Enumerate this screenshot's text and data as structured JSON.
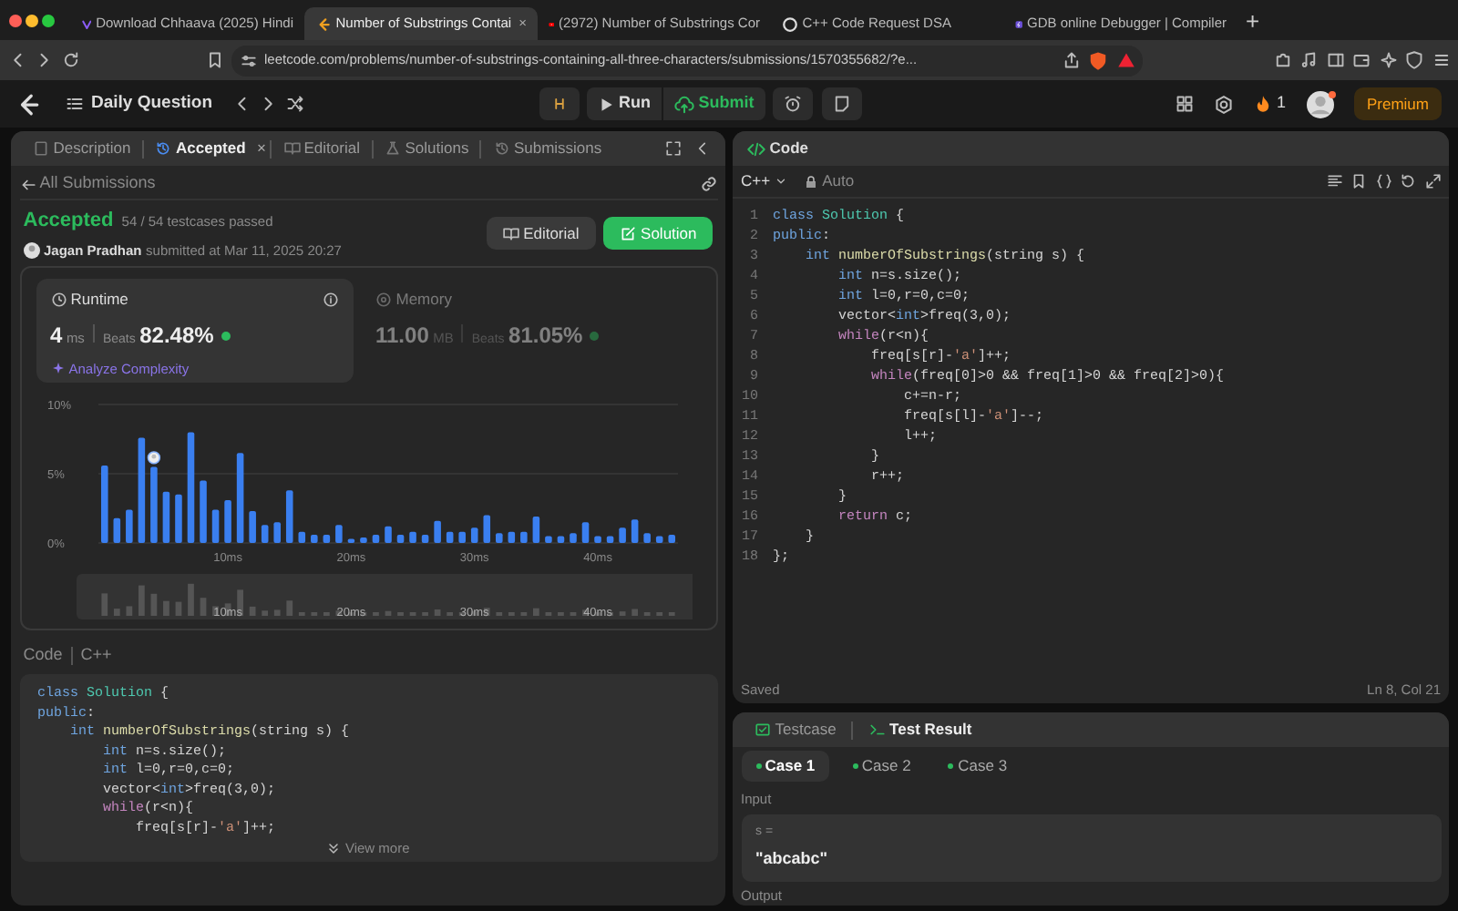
{
  "browser_tabs": [
    {
      "title": "Download Chhaava (2025) Hindi",
      "kind": "vmovie",
      "selected": false
    },
    {
      "title": "Number of Substrings Contai",
      "kind": "leetcode",
      "selected": true,
      "close": "×"
    },
    {
      "title": "(2972) Number of Substrings Cor",
      "kind": "youtube",
      "selected": false
    },
    {
      "title": "C++ Code Request DSA",
      "kind": "chat",
      "selected": false
    },
    {
      "title": "GDB online Debugger | Compiler",
      "kind": "gdb",
      "selected": false
    }
  ],
  "new_tab": "+",
  "address": "leetcode.com/problems/number-of-substrings-containing-all-three-characters/submissions/1570355682/?e...",
  "topbar": {
    "title": "Daily Question",
    "run": "Run",
    "submit": "Submit",
    "streak": "1",
    "premium": "Premium"
  },
  "left_tabs": [
    {
      "label": "Description",
      "kind": "doc",
      "selected": false
    },
    {
      "label": "Accepted",
      "kind": "history",
      "selected": true,
      "close": "×"
    },
    {
      "label": "Editorial",
      "kind": "book",
      "selected": false
    },
    {
      "label": "Solutions",
      "kind": "flask",
      "selected": false
    },
    {
      "label": "Submissions",
      "kind": "history",
      "selected": false
    }
  ],
  "back_link": "All Submissions",
  "submission": {
    "status": "Accepted",
    "testcases": "54 / 54 testcases passed",
    "user": "Jagan Pradhan",
    "submitted": "submitted at Mar 11, 2025 20:27",
    "editorial_button": "Editorial",
    "solution_button": "Solution"
  },
  "stats": [
    {
      "title": "Runtime",
      "value": "4",
      "unit": "ms",
      "beats_label": "Beats",
      "beats": "82.48%",
      "selected": true,
      "analyze": "Analyze Complexity"
    },
    {
      "title": "Memory",
      "value": "11.00",
      "unit": "MB",
      "beats_label": "Beats",
      "beats": "81.05%",
      "selected": false
    }
  ],
  "chart_data": {
    "type": "bar",
    "x": [
      0,
      1,
      2,
      3,
      4,
      5,
      6,
      7,
      8,
      9,
      10,
      11,
      12,
      13,
      14,
      15,
      16,
      17,
      18,
      19,
      20,
      21,
      22,
      23,
      24,
      25,
      26,
      27,
      28,
      29,
      30,
      31,
      32,
      33,
      34,
      35,
      36,
      37,
      38,
      39,
      40,
      41,
      42,
      43,
      44,
      45,
      46
    ],
    "values": [
      5.6,
      1.8,
      2.4,
      7.6,
      5.5,
      3.7,
      3.5,
      8.0,
      4.5,
      2.4,
      3.1,
      6.5,
      2.3,
      1.3,
      1.5,
      3.8,
      0.8,
      0.6,
      0.6,
      1.3,
      0.3,
      0.4,
      0.6,
      1.2,
      0.6,
      0.8,
      0.6,
      1.6,
      0.8,
      0.8,
      1.1,
      2.0,
      0.7,
      0.8,
      0.8,
      1.9,
      0.5,
      0.5,
      0.7,
      1.5,
      0.5,
      0.5,
      1.1,
      1.7,
      0.7,
      0.5,
      0.6
    ],
    "xlim": [
      -0.5,
      46.5
    ],
    "xticks": [
      {
        "value": 10,
        "label": "10ms"
      },
      {
        "value": 20,
        "label": "20ms"
      },
      {
        "value": 30,
        "label": "30ms"
      },
      {
        "value": 40,
        "label": "40ms"
      }
    ],
    "yticks": [
      {
        "value": 0,
        "label": "0%"
      },
      {
        "value": 5,
        "label": "5%"
      },
      {
        "value": 10,
        "label": "10%"
      }
    ],
    "ylim": [
      0,
      10
    ]
  },
  "overview_labels": [
    "10ms",
    "20ms",
    "30ms",
    "40ms"
  ],
  "code_preview": {
    "label": "Code",
    "language": "C++",
    "view_more": "View more",
    "lines": [
      [
        {
          "text": "class ",
          "kind": "keyword"
        },
        {
          "text": "Solution",
          "kind": "type"
        },
        {
          "text": " {"
        }
      ],
      [
        {
          "text": "public",
          "kind": "keyword"
        },
        {
          "text": ":"
        }
      ],
      [
        {
          "text": "    int ",
          "kind": "keyword"
        },
        {
          "text": "numberOfSubstrings",
          "kind": "function"
        },
        {
          "text": "(string s) {"
        }
      ],
      [
        {
          "text": "        int ",
          "kind": "keyword"
        },
        {
          "text": "n=s.size();"
        }
      ],
      [
        {
          "text": "        int ",
          "kind": "keyword"
        },
        {
          "text": "l=0,r=0,c=0;"
        }
      ],
      [
        {
          "text": "        vector<"
        },
        {
          "text": "int",
          "kind": "keyword"
        },
        {
          "text": ">freq(3,0);"
        }
      ],
      [
        {
          "text": "        while",
          "kind": "control"
        },
        {
          "text": "(r<n){"
        }
      ],
      [
        {
          "text": "            freq[s[r]-"
        },
        {
          "text": "'a'",
          "kind": "string"
        },
        {
          "text": "]++;"
        }
      ]
    ]
  },
  "editor": {
    "title": "Code",
    "language": "C++",
    "mode": "Auto",
    "saved": "Saved",
    "cursor": "Ln 8, Col 21",
    "lines": [
      {
        "number": "1",
        "tokens": [
          {
            "text": "class ",
            "kind": "keyword"
          },
          {
            "text": "Solution",
            "kind": "type"
          },
          {
            "text": " {"
          }
        ]
      },
      {
        "number": "2",
        "tokens": [
          {
            "text": "public",
            "kind": "keyword"
          },
          {
            "text": ":"
          }
        ]
      },
      {
        "number": "3",
        "tokens": [
          {
            "text": "    int ",
            "kind": "keyword"
          },
          {
            "text": "numberOfSubstrings",
            "kind": "function"
          },
          {
            "text": "(string s) {"
          }
        ]
      },
      {
        "number": "4",
        "tokens": [
          {
            "text": "        int ",
            "kind": "keyword"
          },
          {
            "text": "n=s.size();"
          }
        ]
      },
      {
        "number": "5",
        "tokens": [
          {
            "text": "        int ",
            "kind": "keyword"
          },
          {
            "text": "l=0,r=0,c=0;"
          }
        ]
      },
      {
        "number": "6",
        "tokens": [
          {
            "text": "        vector<"
          },
          {
            "text": "int",
            "kind": "keyword"
          },
          {
            "text": ">freq(3,0);"
          }
        ]
      },
      {
        "number": "7",
        "tokens": [
          {
            "text": "        while",
            "kind": "control"
          },
          {
            "text": "(r<n){"
          }
        ]
      },
      {
        "number": "8",
        "tokens": [
          {
            "text": "            freq[s[r]-"
          },
          {
            "text": "'a'",
            "kind": "string"
          },
          {
            "text": "]++;"
          }
        ]
      },
      {
        "number": "9",
        "tokens": [
          {
            "text": "            while",
            "kind": "control"
          },
          {
            "text": "(freq[0]>0 && freq[1]>0 && freq[2]>0){"
          }
        ]
      },
      {
        "number": "10",
        "tokens": [
          {
            "text": "                c+=n-r;"
          }
        ]
      },
      {
        "number": "11",
        "tokens": [
          {
            "text": "                freq[s[l]-"
          },
          {
            "text": "'a'",
            "kind": "string"
          },
          {
            "text": "]--;"
          }
        ]
      },
      {
        "number": "12",
        "tokens": [
          {
            "text": "                l++;"
          }
        ]
      },
      {
        "number": "13",
        "tokens": [
          {
            "text": "            }"
          }
        ]
      },
      {
        "number": "14",
        "tokens": [
          {
            "text": "            r++;"
          }
        ]
      },
      {
        "number": "15",
        "tokens": [
          {
            "text": "        }"
          }
        ]
      },
      {
        "number": "16",
        "tokens": [
          {
            "text": "        return",
            "kind": "control"
          },
          {
            "text": " c;"
          }
        ]
      },
      {
        "number": "17",
        "tokens": [
          {
            "text": "    }"
          }
        ]
      },
      {
        "number": "18",
        "tokens": [
          {
            "text": "};"
          }
        ]
      }
    ]
  },
  "console": {
    "tabs": [
      {
        "label": "Testcase",
        "kind": "check",
        "selected": false
      },
      {
        "label": "Test Result",
        "kind": "terminal",
        "selected": true
      }
    ],
    "cases": [
      {
        "label": "Case 1",
        "selected": true
      },
      {
        "label": "Case 2",
        "selected": false
      },
      {
        "label": "Case 3",
        "selected": false
      }
    ],
    "input_label": "Input",
    "variable": "s =",
    "value": "\"abcabc\"",
    "output_label": "Output"
  }
}
